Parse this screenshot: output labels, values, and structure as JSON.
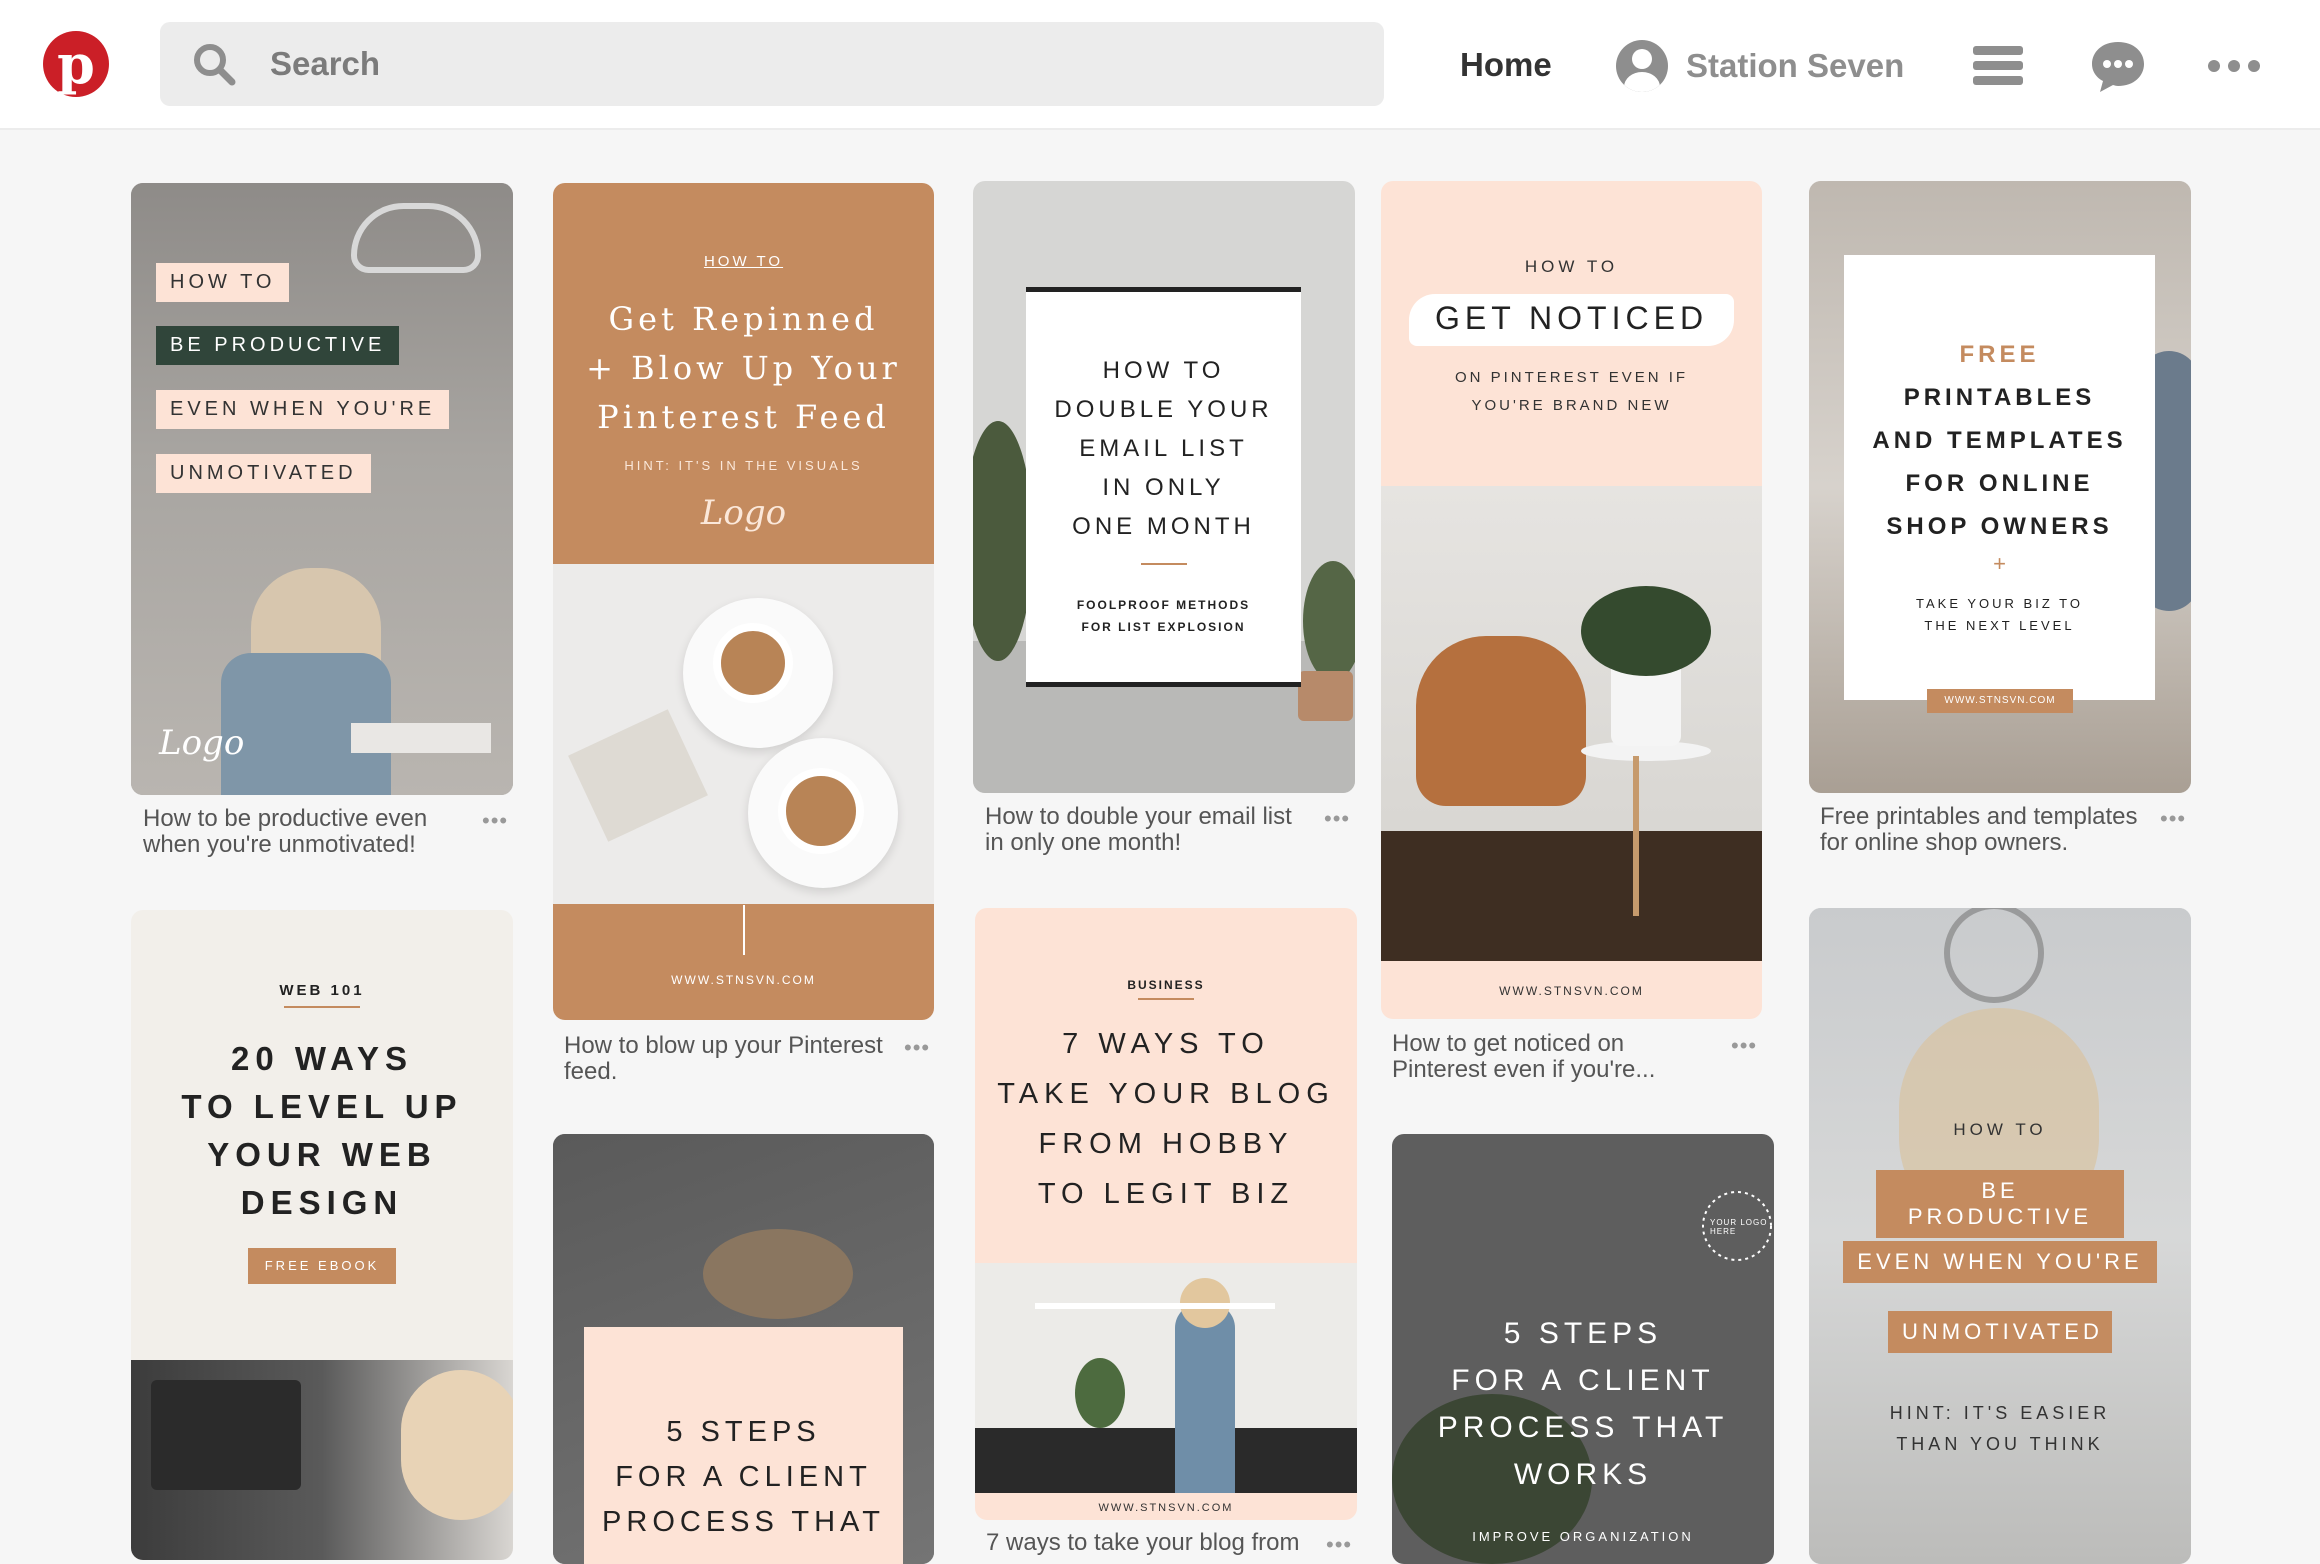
{
  "header": {
    "search_placeholder": "Search",
    "nav_home": "Home",
    "user_name": "Station Seven",
    "icons": [
      "pinterest-logo",
      "search-icon",
      "user-avatar",
      "menu-icon",
      "messages-icon",
      "more-icon"
    ]
  },
  "colors": {
    "brand": "#cb1f27",
    "caramel": "#c48b5f",
    "blush": "#fde3d6",
    "slate": "#5e5e5e"
  },
  "pins": {
    "p1": {
      "lines": [
        "HOW TO",
        "BE PRODUCTIVE",
        "EVEN WHEN YOU'RE",
        "UNMOTIVATED"
      ],
      "logo": "Logo",
      "caption": [
        "How to be productive even",
        "when you're unmotivated!"
      ]
    },
    "p2": {
      "kicker": "HOW TO",
      "lines": [
        "Get Repinned",
        "+ Blow Up Your",
        "Pinterest Feed"
      ],
      "hint": "HINT: IT'S IN THE VISUALS",
      "logo": "Logo",
      "url": "WWW.STNSVN.COM",
      "caption": [
        "How to blow up your Pinterest",
        "feed."
      ]
    },
    "p3": {
      "lines": [
        "HOW TO",
        "DOUBLE YOUR",
        "EMAIL LIST",
        "IN ONLY",
        "ONE MONTH"
      ],
      "sub": [
        "FOOLPROOF METHODS",
        "FOR LIST EXPLOSION"
      ],
      "caption": [
        "How to double your email list",
        "in only one month!"
      ]
    },
    "p4": {
      "kicker": "HOW TO",
      "title": "GET NOTICED",
      "sub": [
        "ON PINTEREST EVEN IF",
        "YOU'RE BRAND NEW"
      ],
      "url": "WWW.STNSVN.COM",
      "caption": [
        "How to get noticed on",
        "Pinterest even if you're..."
      ]
    },
    "p5": {
      "lines": [
        "FREE",
        "PRINTABLES",
        "AND TEMPLATES",
        "FOR ONLINE",
        "SHOP OWNERS"
      ],
      "plus": "+",
      "sub": [
        "TAKE YOUR BIZ TO",
        "THE NEXT LEVEL"
      ],
      "url": "WWW.STNSVN.COM",
      "caption": [
        "Free printables and templates",
        "for online shop owners."
      ]
    },
    "p6": {
      "kicker": "WEB 101",
      "lines": [
        "20 WAYS",
        "TO LEVEL UP",
        "YOUR WEB",
        "DESIGN"
      ],
      "button": "FREE EBOOK"
    },
    "p7": {
      "lines": [
        "5 STEPS",
        "FOR A CLIENT",
        "PROCESS THAT"
      ]
    },
    "p8": {
      "kicker": "BUSINESS",
      "lines": [
        "7 WAYS TO",
        "TAKE YOUR BLOG",
        "FROM HOBBY",
        "TO LEGIT BIZ"
      ],
      "url": "WWW.STNSVN.COM",
      "caption": [
        "7 ways to take your blog from"
      ]
    },
    "p9": {
      "lines": [
        "5 STEPS",
        "FOR A CLIENT",
        "PROCESS THAT",
        "WORKS"
      ],
      "sub": "IMPROVE ORGANIZATION",
      "badge": "YOUR LOGO HERE"
    },
    "p10": {
      "kicker": "HOW TO",
      "lines": [
        "BE PRODUCTIVE",
        "EVEN WHEN YOU'RE",
        "UNMOTIVATED"
      ],
      "hint": [
        "HINT: IT'S EASIER",
        "THAN YOU THINK"
      ]
    }
  }
}
